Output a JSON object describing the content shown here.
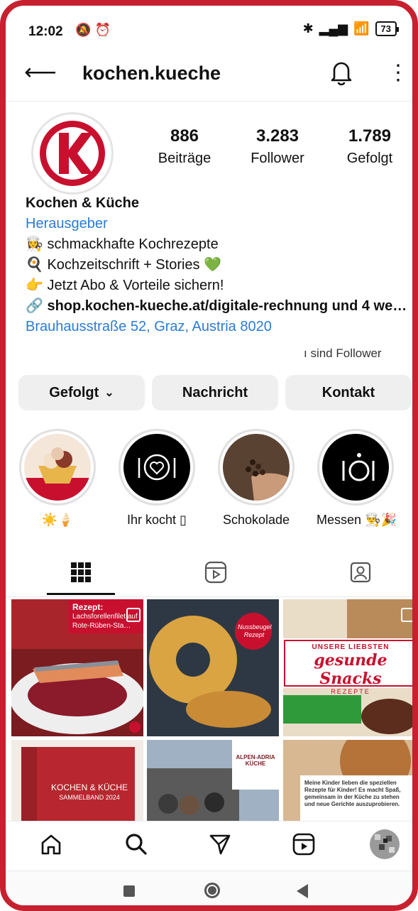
{
  "status": {
    "time": "12:02",
    "battery": "73"
  },
  "header": {
    "username": "kochen.kueche"
  },
  "stats": [
    {
      "num": "886",
      "label": "Beiträge"
    },
    {
      "num": "3.283",
      "label": "Follower"
    },
    {
      "num": "1.789",
      "label": "Gefolgt"
    }
  ],
  "bio": {
    "name": "Kochen & Küche",
    "category": "Herausgeber",
    "line1": "👩‍🍳 schmackhafte Kochrezepte",
    "line2": "🍳 Kochzeitschrift + Stories 💚",
    "line3": "👉 Jetzt Abo & Vorteile sichern!",
    "link": "shop.kochen-kueche.at/digitale-rechnung und 4 we…",
    "address": "Brauhausstraße 52, Graz, Austria 8020",
    "followers_note": "ı sind Follower"
  },
  "buttons": {
    "followed": "Gefolgt",
    "message": "Nachricht",
    "contact": "Kontakt"
  },
  "highlights": [
    {
      "label": "☀️🍦"
    },
    {
      "label": "Ihr kocht ▯"
    },
    {
      "label": "Schokolade"
    },
    {
      "label": "Messen 👨‍🍳🎉"
    }
  ],
  "posts": {
    "p1_title": "Rezept:",
    "p1_sub": "Lachsforellenfilet auf Rote-Rüben-Sta…",
    "p2_badge": "Nussbeugel Rezept",
    "p3_kicker": "UNSERE LIEBSTEN",
    "p3_title": "gesunde Snacks",
    "p3_sub": "REZEPTE",
    "p4_title": "KOCHEN & KÜCHE",
    "p4_sub": "SAMMELBAND 2024",
    "p5_sign": "ALPEN-ADRIA KÜCHE",
    "p6_text": "Meine Kinder lieben die speziellen Rezepte für Kinder! Es macht Spaß, gemeinsam in der Küche zu stehen und neue Gerichte auszuprobieren."
  },
  "colors": {
    "frame": "#c7202f",
    "link_blue": "#2c7bd3",
    "brand_red": "#c8102e"
  }
}
